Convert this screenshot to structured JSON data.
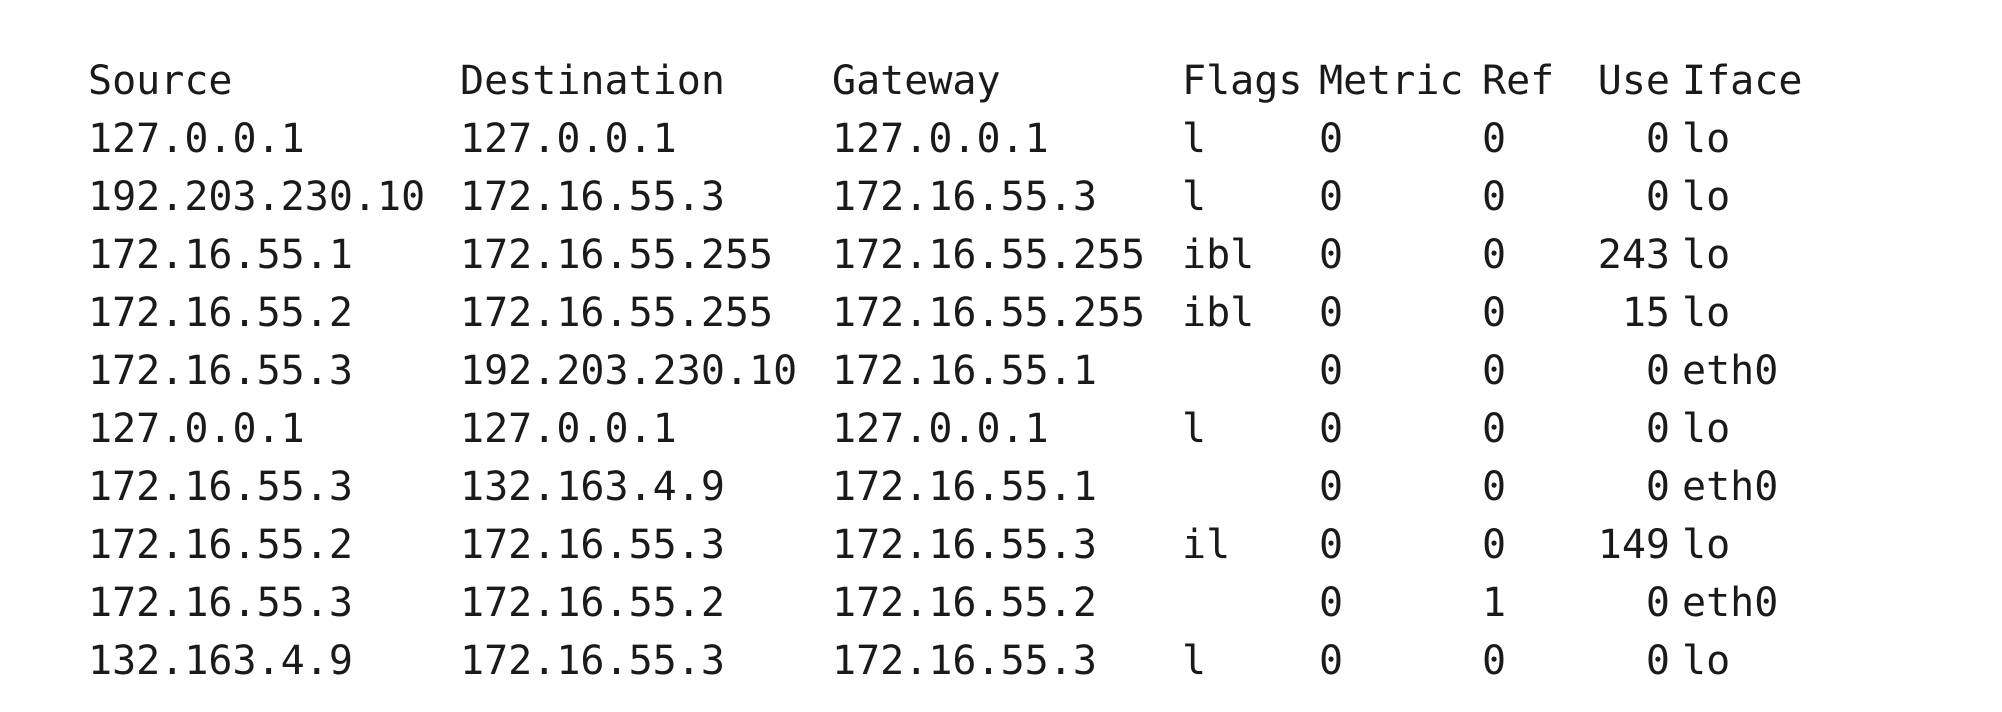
{
  "table": {
    "headers": {
      "source": "Source",
      "destination": "Destination",
      "gateway": "Gateway",
      "flags": "Flags",
      "metric": "Metric",
      "ref": "Ref",
      "use": "Use",
      "iface": "Iface"
    },
    "rows": [
      {
        "source": "127.0.0.1",
        "destination": "127.0.0.1",
        "gateway": "127.0.0.1",
        "flags": "l",
        "metric": "0",
        "ref": "0",
        "use": "0",
        "iface": "lo"
      },
      {
        "source": "192.203.230.10",
        "destination": "172.16.55.3",
        "gateway": "172.16.55.3",
        "flags": "l",
        "metric": "0",
        "ref": "0",
        "use": "0",
        "iface": "lo"
      },
      {
        "source": "172.16.55.1",
        "destination": "172.16.55.255",
        "gateway": "172.16.55.255",
        "flags": "ibl",
        "metric": "0",
        "ref": "0",
        "use": "243",
        "iface": "lo"
      },
      {
        "source": "172.16.55.2",
        "destination": "172.16.55.255",
        "gateway": "172.16.55.255",
        "flags": "ibl",
        "metric": "0",
        "ref": "0",
        "use": "15",
        "iface": "lo"
      },
      {
        "source": "172.16.55.3",
        "destination": "192.203.230.10",
        "gateway": "172.16.55.1",
        "flags": "",
        "metric": "0",
        "ref": "0",
        "use": "0",
        "iface": "eth0"
      },
      {
        "source": "127.0.0.1",
        "destination": "127.0.0.1",
        "gateway": "127.0.0.1",
        "flags": "l",
        "metric": "0",
        "ref": "0",
        "use": "0",
        "iface": "lo"
      },
      {
        "source": "172.16.55.3",
        "destination": "132.163.4.9",
        "gateway": "172.16.55.1",
        "flags": "",
        "metric": "0",
        "ref": "0",
        "use": "0",
        "iface": "eth0"
      },
      {
        "source": "172.16.55.2",
        "destination": "172.16.55.3",
        "gateway": "172.16.55.3",
        "flags": "il",
        "metric": "0",
        "ref": "0",
        "use": "149",
        "iface": "lo"
      },
      {
        "source": "172.16.55.3",
        "destination": "172.16.55.2",
        "gateway": "172.16.55.2",
        "flags": "",
        "metric": "0",
        "ref": "1",
        "use": "0",
        "iface": "eth0"
      },
      {
        "source": "132.163.4.9",
        "destination": "172.16.55.3",
        "gateway": "172.16.55.3",
        "flags": "l",
        "metric": "0",
        "ref": "0",
        "use": "0",
        "iface": "lo"
      }
    ]
  }
}
